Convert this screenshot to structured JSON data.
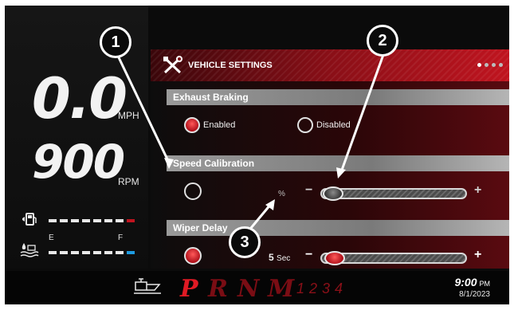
{
  "speed": {
    "value": "0.0",
    "unit": "MPH"
  },
  "rpm": {
    "value": "900",
    "unit": "RPM"
  },
  "fuel": {
    "empty_label": "E",
    "full_label": "F"
  },
  "settings": {
    "title": "VEHICLE SETTINGS",
    "page_dots": 4,
    "exhaust_braking": {
      "header": "Exhaust Braking",
      "options": [
        {
          "label": "Enabled",
          "selected": true
        },
        {
          "label": "Disabled",
          "selected": false
        }
      ]
    },
    "speed_calibration": {
      "header": "Speed Calibration",
      "unit": "%",
      "minus": "−",
      "plus": "+"
    },
    "wiper_delay": {
      "header": "Wiper Delay",
      "value": "5",
      "unit": "Sec",
      "minus": "−",
      "plus": "+"
    }
  },
  "footer": {
    "gears": [
      "P",
      "R",
      "N",
      "M"
    ],
    "gear_numbers": [
      "1",
      "2",
      "3",
      "4"
    ],
    "time": "9:00",
    "ampm": "PM",
    "date": "8/1/2023"
  },
  "callouts": [
    "1",
    "2",
    "3"
  ],
  "colors": {
    "accent": "#c0141f",
    "selected_gear": "#e01a24",
    "fuel_low": "#c0141f",
    "def_level": "#1e9be0"
  }
}
